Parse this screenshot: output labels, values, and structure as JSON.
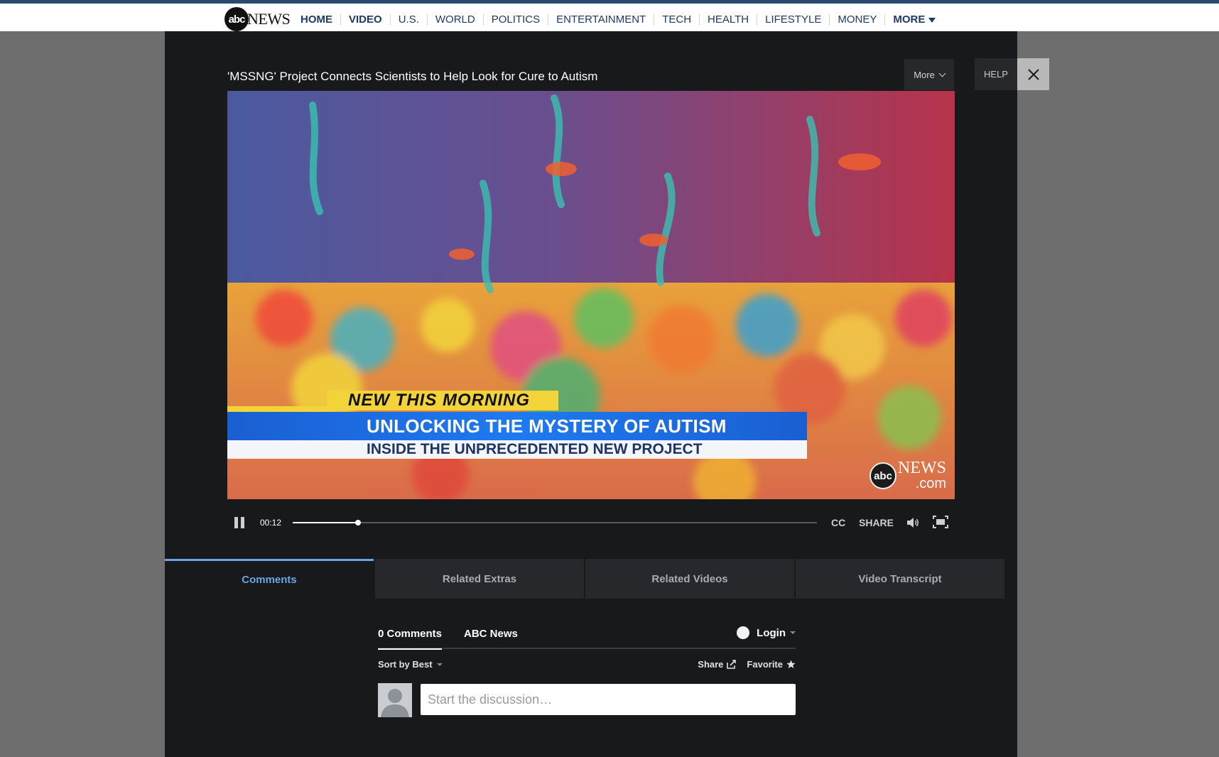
{
  "nav": {
    "logo_abc": "abc",
    "logo_news": "NEWS",
    "items": [
      "HOME",
      "VIDEO",
      "U.S.",
      "WORLD",
      "POLITICS",
      "ENTERTAINMENT",
      "TECH",
      "HEALTH",
      "LIFESTYLE",
      "MONEY"
    ],
    "more_label": "MORE"
  },
  "player": {
    "title": "'MSSNG' Project Connects Scientists to Help Look for Cure to Autism",
    "more_label": "More",
    "help_label": "HELP",
    "lower_third": {
      "tag": "NEW THIS MORNING",
      "headline": "UNLOCKING THE MYSTERY OF AUTISM",
      "subline": "INSIDE THE UNPRECEDENTED NEW PROJECT"
    },
    "watermark": {
      "abc": "abc",
      "news": "NEWS",
      "domain": ".com"
    },
    "controls": {
      "time": "00:12",
      "progress_fraction": 0.125,
      "cc_label": "CC",
      "share_label": "SHARE"
    }
  },
  "tabs": [
    {
      "label": "Comments",
      "active": true
    },
    {
      "label": "Related Extras",
      "active": false
    },
    {
      "label": "Related Videos",
      "active": false
    },
    {
      "label": "Video Transcript",
      "active": false
    }
  ],
  "comments": {
    "count_label": "0 Comments",
    "site_label": "ABC News",
    "login_label": "Login",
    "sort_label": "Sort by Best",
    "share_label": "Share",
    "favorite_label": "Favorite",
    "input_placeholder": "Start the discussion…"
  },
  "colors": {
    "nav_text": "#1f3a63",
    "active_tab": "#6aa6e6",
    "panel_bg": "#18191b"
  }
}
